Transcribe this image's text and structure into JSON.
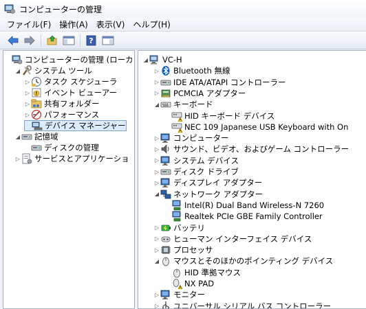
{
  "window": {
    "title": "コンピューターの管理"
  },
  "menu": [
    "ファイル(F)",
    "操作(A)",
    "表示(V)",
    "ヘルプ(H)"
  ],
  "left_tree": [
    {
      "label": "コンピューターの管理 (ローカ",
      "arrow": "",
      "icon": "computer-management-icon",
      "indent": 0
    },
    {
      "label": "システム ツール",
      "arrow": "open",
      "icon": "system-tools-icon",
      "indent": 1
    },
    {
      "label": "タスク スケジューラ",
      "arrow": "closed",
      "icon": "task-scheduler-icon",
      "indent": 2
    },
    {
      "label": "イベント ビューアー",
      "arrow": "closed",
      "icon": "event-viewer-icon",
      "indent": 2
    },
    {
      "label": "共有フォルダー",
      "arrow": "closed",
      "icon": "shared-folder-icon",
      "indent": 2
    },
    {
      "label": "パフォーマンス",
      "arrow": "closed",
      "icon": "performance-icon",
      "indent": 2
    },
    {
      "label": "デバイス マネージャー",
      "arrow": "",
      "icon": "device-manager-icon",
      "indent": 2,
      "selected": true
    },
    {
      "label": "記憶域",
      "arrow": "open",
      "icon": "storage-icon",
      "indent": 1
    },
    {
      "label": "ディスクの管理",
      "arrow": "",
      "icon": "disk-management-icon",
      "indent": 2
    },
    {
      "label": "サービスとアプリケーショ",
      "arrow": "closed",
      "icon": "services-icon",
      "indent": 1
    }
  ],
  "right_tree": [
    {
      "label": "VC-H",
      "arrow": "open",
      "icon": "computer-icon",
      "indent": 0
    },
    {
      "label": "Bluetooth 無線",
      "arrow": "closed",
      "icon": "bluetooth-icon",
      "indent": 1
    },
    {
      "label": "IDE ATA/ATAPI コントローラー",
      "arrow": "closed",
      "icon": "ide-controller-icon",
      "indent": 1
    },
    {
      "label": "PCMCIA アダプター",
      "arrow": "closed",
      "icon": "pcmcia-icon",
      "indent": 1
    },
    {
      "label": "キーボード",
      "arrow": "open",
      "icon": "keyboard-icon",
      "indent": 1
    },
    {
      "label": "HID キーボード デバイス",
      "arrow": "",
      "icon": "keyboard-warning-icon",
      "indent": 2
    },
    {
      "label": "NEC 109 Japanese USB Keyboard with On",
      "arrow": "",
      "icon": "keyboard-warning-icon",
      "indent": 2
    },
    {
      "label": "コンピューター",
      "arrow": "closed",
      "icon": "monitor-icon",
      "indent": 1
    },
    {
      "label": "サウンド、ビデオ、およびゲーム コントローラー",
      "arrow": "closed",
      "icon": "sound-icon",
      "indent": 1
    },
    {
      "label": "システム デバイス",
      "arrow": "closed",
      "icon": "monitor-icon",
      "indent": 1
    },
    {
      "label": "ディスク ドライブ",
      "arrow": "closed",
      "icon": "disk-drive-icon",
      "indent": 1
    },
    {
      "label": "ディスプレイ アダプター",
      "arrow": "closed",
      "icon": "monitor-icon",
      "indent": 1
    },
    {
      "label": "ネットワーク アダプター",
      "arrow": "open",
      "icon": "network-icon",
      "indent": 1
    },
    {
      "label": "Intel(R) Dual Band Wireless-N 7260",
      "arrow": "",
      "icon": "network-card-icon",
      "indent": 2
    },
    {
      "label": "Realtek PCIe GBE Family Controller",
      "arrow": "",
      "icon": "network-card-icon",
      "indent": 2
    },
    {
      "label": "バッテリ",
      "arrow": "closed",
      "icon": "battery-icon",
      "indent": 1
    },
    {
      "label": "ヒューマン インターフェイス デバイス",
      "arrow": "closed",
      "icon": "hid-icon",
      "indent": 1
    },
    {
      "label": "プロセッサ",
      "arrow": "closed",
      "icon": "processor-icon",
      "indent": 1
    },
    {
      "label": "マウスとそのほかのポインティング デバイス",
      "arrow": "open",
      "icon": "mouse-icon",
      "indent": 1
    },
    {
      "label": "HID 準拠マウス",
      "arrow": "",
      "icon": "mouse-icon",
      "indent": 2
    },
    {
      "label": "NX PAD",
      "arrow": "",
      "icon": "mouse-warning-icon",
      "indent": 2
    },
    {
      "label": "モニター",
      "arrow": "closed",
      "icon": "monitor-icon",
      "indent": 1
    },
    {
      "label": "ユニバーサル シリアル バス コントローラー",
      "arrow": "closed",
      "icon": "usb-icon",
      "indent": 1
    }
  ]
}
